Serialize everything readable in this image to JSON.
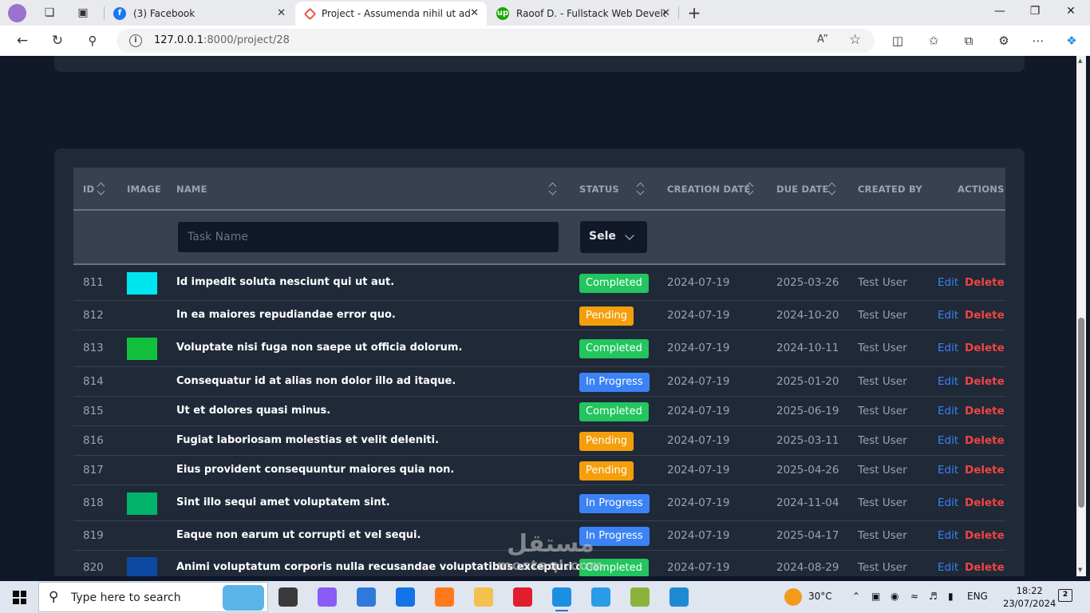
{
  "browser": {
    "tabs": [
      {
        "title": "(3) Facebook",
        "favicon_color": "#1877f2",
        "active": false
      },
      {
        "title": "Project - Assumenda nihil ut adip",
        "favicon_color": "#f05340",
        "active": true
      },
      {
        "title": "Raoof D. - Fullstack Web Develop",
        "favicon_color": "#14a800",
        "active": false
      }
    ],
    "url_host": "127.0.0.1",
    "url_rest": ":8000/project/28",
    "icons": [
      "profile-icon",
      "workspaces-icon",
      "tab-actions-icon",
      "close-icon",
      "new-tab-icon",
      "minimize-icon",
      "maximize-icon",
      "window-close-icon",
      "back-icon",
      "refresh-icon",
      "search-icon",
      "site-info-icon",
      "read-aloud-icon",
      "favorite-star-icon",
      "split-screen-icon",
      "favorites-icon",
      "collections-icon",
      "extensions-icon",
      "more-icon",
      "copilot-icon"
    ]
  },
  "table": {
    "headers": {
      "id": "ID",
      "image": "IMAGE",
      "name": "NAME",
      "status": "STATUS",
      "creation_date": "CREATION DATE",
      "due_date": "DUE DATE",
      "created_by": "CREATED BY",
      "actions": "ACTIONS"
    },
    "filters": {
      "task_name_placeholder": "Task Name",
      "status_value": "Select Status"
    },
    "edit_label": "Edit",
    "delete_label": "Delete",
    "rows": [
      {
        "id": "811",
        "image_color": "#00e5f0",
        "name": "Id impedit soluta nesciunt qui ut aut.",
        "status": "Completed",
        "status_kind": "completed",
        "created": "2024-07-19",
        "due": "2025-03-26",
        "created_by": "Test User"
      },
      {
        "id": "812",
        "image_color": "",
        "name": "In ea maiores repudiandae error quo.",
        "status": "Pending",
        "status_kind": "pending",
        "created": "2024-07-19",
        "due": "2024-10-20",
        "created_by": "Test User"
      },
      {
        "id": "813",
        "image_color": "#11c13b",
        "name": "Voluptate nisi fuga non saepe ut officia dolorum.",
        "status": "Completed",
        "status_kind": "completed",
        "created": "2024-07-19",
        "due": "2024-10-11",
        "created_by": "Test User"
      },
      {
        "id": "814",
        "image_color": "",
        "name": "Consequatur id at alias non dolor illo ad itaque.",
        "status": "In Progress",
        "status_kind": "progress",
        "created": "2024-07-19",
        "due": "2025-01-20",
        "created_by": "Test User"
      },
      {
        "id": "815",
        "image_color": "",
        "name": "Ut et dolores quasi minus.",
        "status": "Completed",
        "status_kind": "completed",
        "created": "2024-07-19",
        "due": "2025-06-19",
        "created_by": "Test User"
      },
      {
        "id": "816",
        "image_color": "",
        "name": "Fugiat laboriosam molestias et velit deleniti.",
        "status": "Pending",
        "status_kind": "pending",
        "created": "2024-07-19",
        "due": "2025-03-11",
        "created_by": "Test User"
      },
      {
        "id": "817",
        "image_color": "",
        "name": "Eius provident consequuntur maiores quia non.",
        "status": "Pending",
        "status_kind": "pending",
        "created": "2024-07-19",
        "due": "2025-04-26",
        "created_by": "Test User"
      },
      {
        "id": "818",
        "image_color": "#02b36b",
        "name": "Sint illo sequi amet voluptatem sint.",
        "status": "In Progress",
        "status_kind": "progress",
        "created": "2024-07-19",
        "due": "2024-11-04",
        "created_by": "Test User"
      },
      {
        "id": "819",
        "image_color": "",
        "name": "Eaque non earum ut corrupti et vel sequi.",
        "status": "In Progress",
        "status_kind": "progress",
        "created": "2024-07-19",
        "due": "2025-04-17",
        "created_by": "Test User"
      },
      {
        "id": "820",
        "image_color": "#0b4aa0",
        "name": "Animi voluptatum corporis nulla recusandae voluptatibus excepturi dolores.",
        "status": "Completed",
        "status_kind": "completed",
        "created": "2024-07-19",
        "due": "2024-08-29",
        "created_by": "Test User"
      }
    ]
  },
  "watermark": {
    "arabic": "مستقل",
    "latin": "mostaql.com"
  },
  "taskbar": {
    "search_placeholder": "Type here to search",
    "weather": "30°C",
    "language": "ENG",
    "time": "18:22",
    "date": "23/07/2024",
    "notification_count": "2",
    "apps": [
      {
        "name": "task-view-icon",
        "color": "#3a3a3a"
      },
      {
        "name": "copilot-icon",
        "color": "#8a5cf6"
      },
      {
        "name": "store-icon",
        "color": "#2f7ad8"
      },
      {
        "name": "mail-icon",
        "color": "#1473e6"
      },
      {
        "name": "firefox-icon",
        "color": "#ff7a1a"
      },
      {
        "name": "file-explorer-icon",
        "color": "#f2c14e"
      },
      {
        "name": "opera-icon",
        "color": "#e01e2e"
      },
      {
        "name": "edge-icon",
        "color": "#1d8fe0"
      },
      {
        "name": "browser-app-icon",
        "color": "#2a9be8"
      },
      {
        "name": "sublime-app-icon",
        "color": "#8bb33b"
      },
      {
        "name": "vscode-icon",
        "color": "#1f8ad2"
      }
    ]
  }
}
